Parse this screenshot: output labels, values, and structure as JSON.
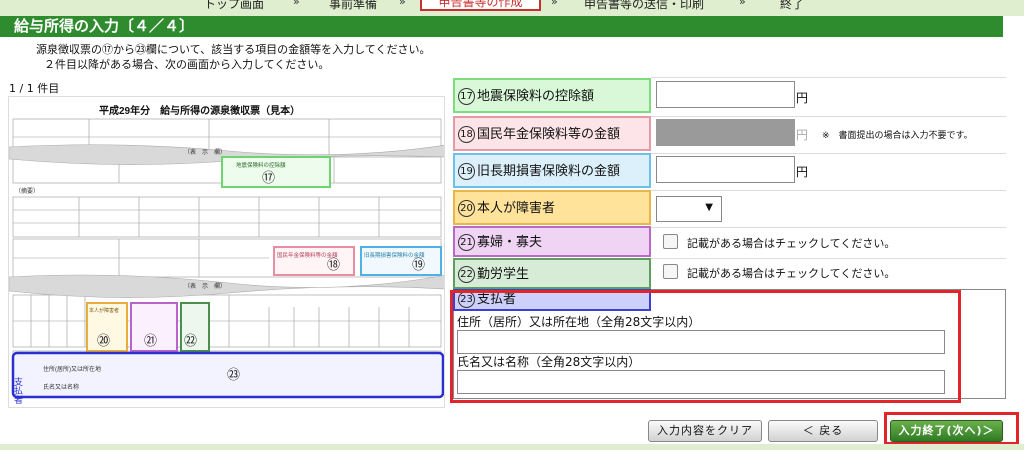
{
  "nav": {
    "items": [
      "トップ画面",
      "事前準備",
      "申告書等の作成",
      "申告書等の送信・印刷",
      "終了"
    ],
    "separator": "»"
  },
  "page": {
    "title": "給与所得の入力〔４／４〕",
    "instruction_1": "源泉徴収票の⑰から㉓欄について、該当する項目の金額等を入力してください。",
    "instruction_2": "２件目以降がある場合、次の画面から入力してください。",
    "count": "1 / 1 件目"
  },
  "document": {
    "title": "平成29年分　給与所得の源泉徴収票（見本）",
    "labels": {
      "display": "（表　示　欄）",
      "summary": "（摘要）",
      "payer": "支払者",
      "address": "住所(居所)又は所在地",
      "name": "氏名又は名称",
      "disabled": "本人が障害者",
      "eq_quake": "地震保険料の控除額",
      "national_pension": "国民年金保険料等の金額",
      "old_long_term": "旧長期損害保険料の金額"
    },
    "markers": [
      "⑰",
      "⑱",
      "⑲",
      "⑳",
      "㉑",
      "㉒",
      "㉓"
    ]
  },
  "fields": {
    "f17": {
      "num": "17",
      "label": "地震保険料の控除額",
      "value": "",
      "unit": "円"
    },
    "f18": {
      "num": "18",
      "label": "国民年金保険料等の金額",
      "value": "",
      "unit": "円",
      "note": "※　書面提出の場合は入力不要です。"
    },
    "f19": {
      "num": "19",
      "label": "旧長期損害保険料の金額",
      "value": "",
      "unit": "円"
    },
    "f20": {
      "num": "20",
      "label": "本人が障害者",
      "selected": "",
      "arrow": "▼"
    },
    "f21": {
      "num": "21",
      "label": "寡婦・寡夫",
      "check_label": "記載がある場合はチェックしてください。"
    },
    "f22": {
      "num": "22",
      "label": "勤労学生",
      "check_label": "記載がある場合はチェックしてください。"
    },
    "f23": {
      "num": "23",
      "label": "支払者",
      "address_label": "住所（居所）又は所在地（全角28文字以内）",
      "address_value": "",
      "name_label": "氏名又は名称（全角28文字以内）",
      "name_value": ""
    }
  },
  "buttons": {
    "clear": "入力内容をクリア",
    "back": "＜ 戻る",
    "next": "入力終了(次へ)＞"
  },
  "colors": {
    "title_green": "#2e8b2e",
    "highlight_red": "#e0262a",
    "f17": "#7ddc7d",
    "f18": "#e59aa8",
    "f19": "#6ec0e8",
    "f20": "#e8b64a",
    "f21": "#b96ac4",
    "f22": "#5e9e5e",
    "f23": "#3b3fd3"
  }
}
